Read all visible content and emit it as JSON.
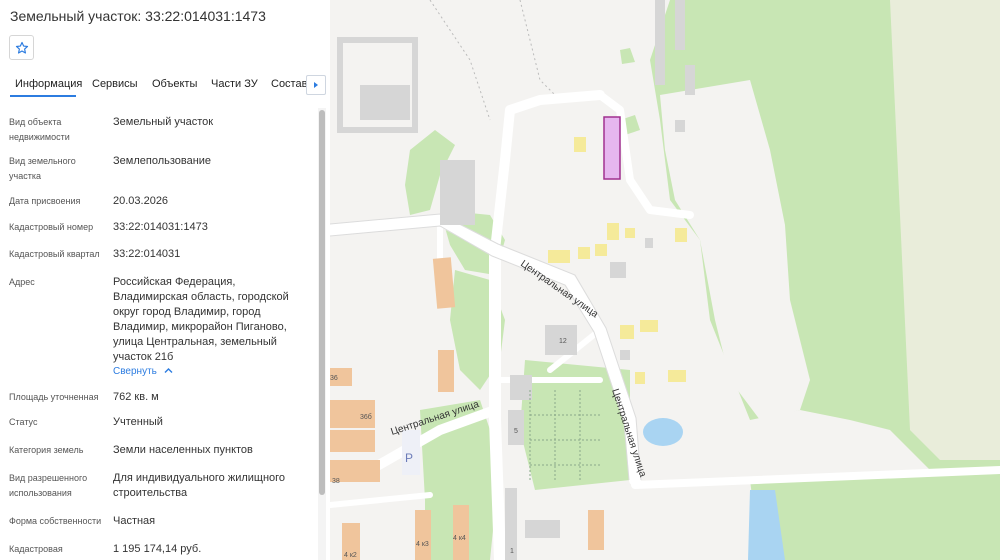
{
  "panel": {
    "title": "Земельный участок: 33:22:014031:1473",
    "favorite_icon": "star-outline-icon",
    "tabs": [
      "Информация",
      "Сервисы",
      "Объекты",
      "Части ЗУ",
      "Состав"
    ],
    "active_tab": "Информация",
    "props": [
      {
        "label": "Вид объекта недвижимости",
        "value": "Земельный участок"
      },
      {
        "label": "Вид земельного участка",
        "value": "Землепользование"
      },
      {
        "label": "Дата присвоения",
        "value": "20.03.2026"
      },
      {
        "label": "Кадастровый номер",
        "value": "33:22:014031:1473"
      },
      {
        "label": "Кадастровый квартал",
        "value": "33:22:014031"
      },
      {
        "label": "Адрес",
        "value": "Российская Федерация, Владимирская область, городской округ город Владимир, город Владимир, микрорайон Пиганово, улица Центральная, земельный участок 21б"
      },
      {
        "label": "Площадь уточненная",
        "value": "762 кв. м"
      },
      {
        "label": "Статус",
        "value": "Учтенный"
      },
      {
        "label": "Категория земель",
        "value": "Земли населенных пунктов"
      },
      {
        "label": "Вид разрешенного использования",
        "value": "Для индивидуального жилищного строительства"
      },
      {
        "label": "Форма собственности",
        "value": "Частная"
      },
      {
        "label": "Кадастровая",
        "value": "1 195 174,14 руб."
      }
    ],
    "collapse_label": "Свернуть"
  },
  "map": {
    "street_labels": [
      "Центральная улица",
      "Центральная улица",
      "Центральная улица"
    ],
    "building_numbers": [
      "12",
      "5",
      "36",
      "36б",
      "38",
      "1",
      "4 к2",
      "4 к3",
      "4 к4"
    ],
    "parking_label": "P",
    "colors": {
      "background": "#f4f3f1",
      "green": "#c8e6b4",
      "road": "#ffffff",
      "highlight": "#e6b6ef",
      "highlight_border": "#a0308f"
    }
  }
}
